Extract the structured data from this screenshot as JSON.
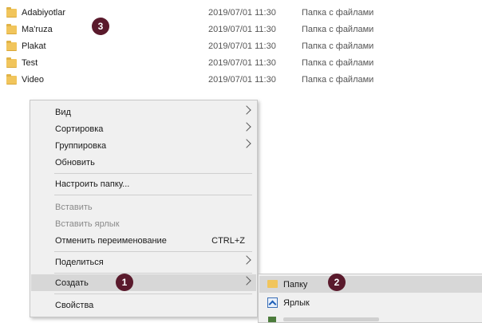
{
  "files": [
    {
      "name": "Adabiyotlar",
      "date": "2019/07/01 11:30",
      "type": "Папка с файлами"
    },
    {
      "name": "Ma'ruza",
      "date": "2019/07/01 11:30",
      "type": "Папка с файлами"
    },
    {
      "name": "Plakat",
      "date": "2019/07/01 11:30",
      "type": "Папка с файлами"
    },
    {
      "name": "Test",
      "date": "2019/07/01 11:30",
      "type": "Папка с файлами"
    },
    {
      "name": "Video",
      "date": "2019/07/01 11:30",
      "type": "Папка с файлами"
    }
  ],
  "badges": {
    "one": "1",
    "two": "2",
    "three": "3"
  },
  "context_menu": {
    "view": "Вид",
    "sort": "Сортировка",
    "group": "Группировка",
    "refresh": "Обновить",
    "customize": "Настроить папку...",
    "paste": "Вставить",
    "paste_shortcut": "Вставить ярлык",
    "undo_rename": "Отменить переименование",
    "undo_shortcut": "CTRL+Z",
    "share": "Поделиться",
    "create": "Создать",
    "properties": "Свойства"
  },
  "submenu": {
    "folder": "Папку",
    "shortcut": "Ярлык"
  },
  "colors": {
    "badge": "#5a1a2c",
    "folder": "#f1c55c",
    "highlight": "#d7d7d7"
  }
}
